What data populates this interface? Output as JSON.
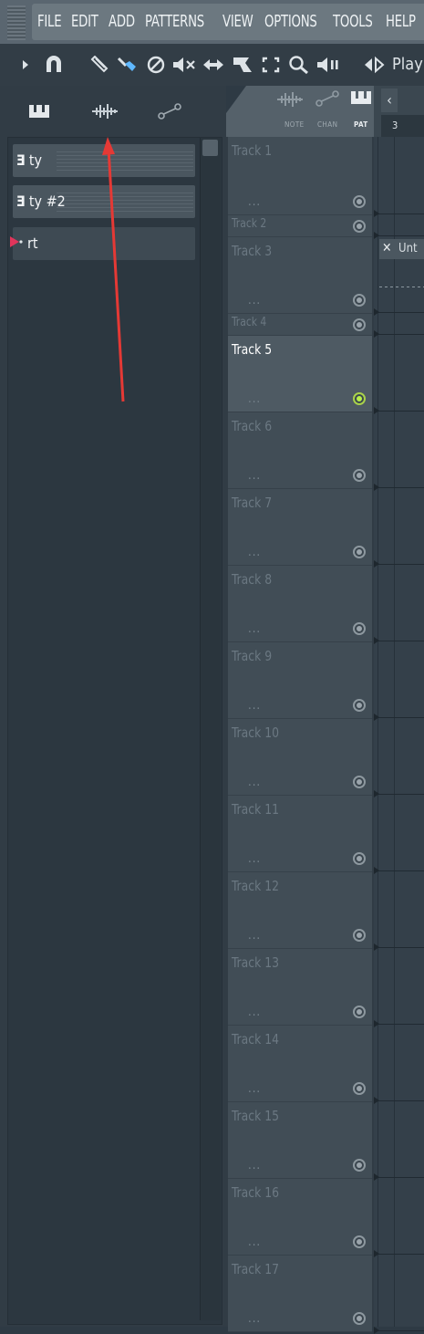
{
  "menu": {
    "items": [
      "FILE",
      "EDIT",
      "ADD",
      "PATTERNS",
      "VIEW",
      "OPTIONS",
      "TOOLS",
      "HELP"
    ]
  },
  "toolbar": {
    "icons": [
      "play-arrow-icon",
      "magnet-icon",
      "pencil-icon",
      "paint-brush-icon",
      "delete-icon",
      "mute-icon",
      "slip-icon",
      "slice-icon",
      "select-icon",
      "zoom-icon",
      "playback-icon",
      "playback-mode-icon"
    ],
    "playback_label": "Play"
  },
  "browser": {
    "tabs": [
      "piano-icon",
      "audio-wave-icon",
      "automation-icon"
    ],
    "items": [
      {
        "label": "ty",
        "icon": "pattern-icon"
      },
      {
        "label": "ty #2",
        "icon": "pattern-icon"
      },
      {
        "label": "rt",
        "icon": "play-marker-icon"
      }
    ]
  },
  "playlist_header": {
    "icons": [
      "audio-wave-icon",
      "automation-icon",
      "piano-icon"
    ],
    "labels": {
      "note": "NOTE",
      "chan": "CHAN",
      "pat": "PAT"
    }
  },
  "ruler": {
    "bar": "3"
  },
  "clip": {
    "label": "Untitled",
    "visible_text": "Unt"
  },
  "tracks": [
    {
      "name": "Track 1",
      "active": false
    },
    {
      "name": "Track 2",
      "active": false
    },
    {
      "name": "Track 3",
      "active": false
    },
    {
      "name": "Track 4",
      "active": false
    },
    {
      "name": "Track 5",
      "active": true
    },
    {
      "name": "Track 6",
      "active": false
    },
    {
      "name": "Track 7",
      "active": false
    },
    {
      "name": "Track 8",
      "active": false
    },
    {
      "name": "Track 9",
      "active": false
    },
    {
      "name": "Track 10",
      "active": false
    },
    {
      "name": "Track 11",
      "active": false
    },
    {
      "name": "Track 12",
      "active": false
    },
    {
      "name": "Track 13",
      "active": false
    },
    {
      "name": "Track 14",
      "active": false
    },
    {
      "name": "Track 15",
      "active": false
    },
    {
      "name": "Track 16",
      "active": false
    },
    {
      "name": "Track 17",
      "active": false
    }
  ],
  "track_dots": "...",
  "colors": {
    "active_led": "#b8f04a",
    "annotation_arrow": "#e53935"
  }
}
